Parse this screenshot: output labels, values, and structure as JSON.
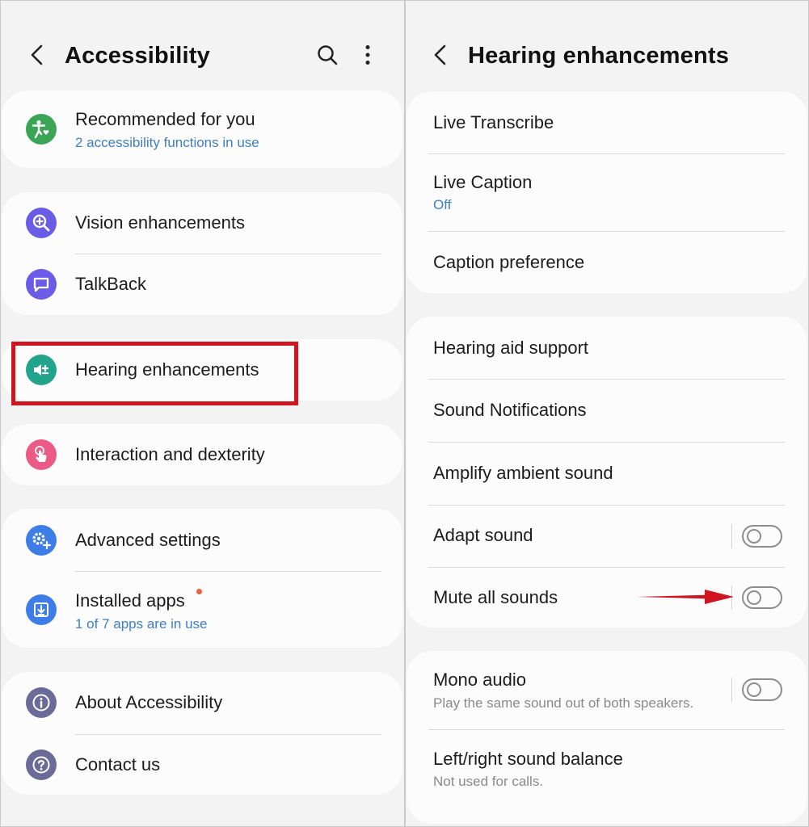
{
  "left": {
    "title": "Accessibility",
    "cards": [
      {
        "items": [
          {
            "title": "Recommended for you",
            "subtitle": "2 accessibility functions in use",
            "icon": "accessibility-person-icon",
            "color": "#3aa655"
          }
        ]
      },
      {
        "items": [
          {
            "title": "Vision enhancements",
            "icon": "magnifier-plus-icon",
            "color": "#6b5ce7"
          },
          {
            "title": "TalkBack",
            "icon": "speech-bubble-icon",
            "color": "#6b5ce7"
          }
        ]
      },
      {
        "items": [
          {
            "title": "Hearing enhancements",
            "icon": "speaker-plus-icon",
            "color": "#22a48c"
          }
        ]
      },
      {
        "items": [
          {
            "title": "Interaction and dexterity",
            "icon": "hand-tap-icon",
            "color": "#ec5a86"
          }
        ]
      },
      {
        "items": [
          {
            "title": "Advanced settings",
            "icon": "gear-plus-icon",
            "color": "#3d7de8"
          },
          {
            "title": "Installed apps",
            "subtitle": "1 of 7 apps are in use",
            "icon": "download-icon",
            "color": "#3d7de8"
          }
        ]
      },
      {
        "items": [
          {
            "title": "About Accessibility",
            "icon": "info-icon",
            "color": "#6b6b9a"
          },
          {
            "title": "Contact us",
            "icon": "question-icon",
            "color": "#6b6b9a"
          }
        ]
      }
    ]
  },
  "right": {
    "title": "Hearing enhancements",
    "cards": [
      {
        "items": [
          {
            "title": "Live Transcribe"
          },
          {
            "title": "Live Caption",
            "subtitle": "Off"
          },
          {
            "title": "Caption preference"
          }
        ]
      },
      {
        "items": [
          {
            "title": "Hearing aid support"
          },
          {
            "title": "Sound Notifications"
          },
          {
            "title": "Amplify ambient sound"
          },
          {
            "title": "Adapt sound",
            "toggle": false
          },
          {
            "title": "Mute all sounds",
            "toggle": false
          }
        ]
      },
      {
        "items": [
          {
            "title": "Mono audio",
            "subtitle": "Play the same sound out of both speakers.",
            "toggle": false
          },
          {
            "title": "Left/right sound balance",
            "subtitle": "Not used for calls."
          }
        ]
      }
    ]
  },
  "colors": {
    "highlight": "#d0151f",
    "link_blue": "#3f7fc2",
    "notification_dot": "#e8643a"
  }
}
